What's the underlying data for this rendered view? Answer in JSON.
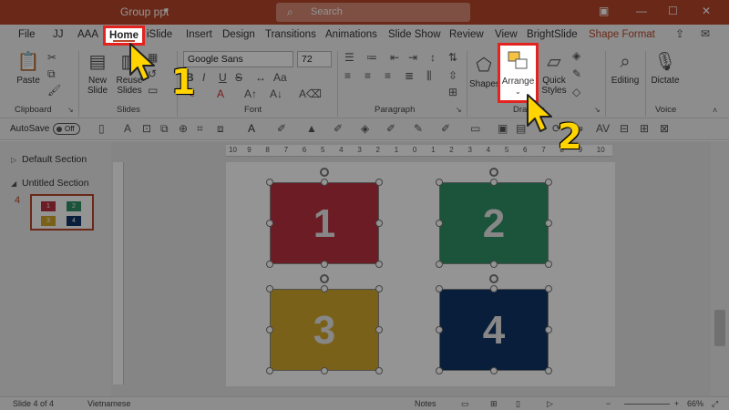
{
  "window": {
    "title": "Group ppt",
    "search_placeholder": "Search"
  },
  "tabs": [
    {
      "label": "File"
    },
    {
      "label": "JJ"
    },
    {
      "label": "AAA"
    },
    {
      "label": "Home"
    },
    {
      "label": "iSlide"
    },
    {
      "label": "Insert"
    },
    {
      "label": "Design"
    },
    {
      "label": "Transitions"
    },
    {
      "label": "Animations"
    },
    {
      "label": "Slide Show"
    },
    {
      "label": "Review"
    },
    {
      "label": "View"
    },
    {
      "label": "BrightSlide"
    },
    {
      "label": "Shape Format"
    }
  ],
  "ribbon": {
    "clipboard": {
      "paste": "Paste",
      "group": "Clipboard"
    },
    "slides": {
      "new_slide_1": "New",
      "new_slide_2": "Slide",
      "reuse_1": "Reuse",
      "reuse_2": "Slides",
      "group": "Slides"
    },
    "font": {
      "family": "Google Sans",
      "size": "72",
      "group": "Font"
    },
    "paragraph": {
      "group": "Paragraph"
    },
    "drawing": {
      "shapes": "Shapes",
      "arrange": "Arrange",
      "quick_1": "Quick",
      "quick_2": "Styles",
      "group": "Drawing"
    },
    "editing": {
      "label": "Editing"
    },
    "voice": {
      "dictate": "Dictate",
      "group": "Voice"
    }
  },
  "qat": {
    "autosave": "AutoSave",
    "toggle": "Off"
  },
  "slide_pane": {
    "sections": [
      "Default Section",
      "Untitled Section"
    ],
    "slide_number": "4",
    "thumb_boxes": [
      "1",
      "2",
      "3",
      "4"
    ]
  },
  "slide": {
    "boxes": [
      {
        "label": "1",
        "color": "#b8313f"
      },
      {
        "label": "2",
        "color": "#2f8f67"
      },
      {
        "label": "3",
        "color": "#d3a72e"
      },
      {
        "label": "4",
        "color": "#0f3565"
      }
    ]
  },
  "ruler_labels": [
    "10",
    "9",
    "8",
    "7",
    "6",
    "5",
    "4",
    "3",
    "2",
    "1",
    "0",
    "1",
    "2",
    "3",
    "4",
    "5",
    "6",
    "7",
    "8",
    "9",
    "10"
  ],
  "status": {
    "slide_info": "Slide 4 of 4",
    "language": "Vietnamese",
    "notes": "Notes",
    "zoom": "66%"
  },
  "annotations": {
    "step1": "1",
    "step2": "2"
  },
  "colors": {
    "accent": "#b7472a",
    "highlight": "#e3231f",
    "step": "#ffd400"
  }
}
